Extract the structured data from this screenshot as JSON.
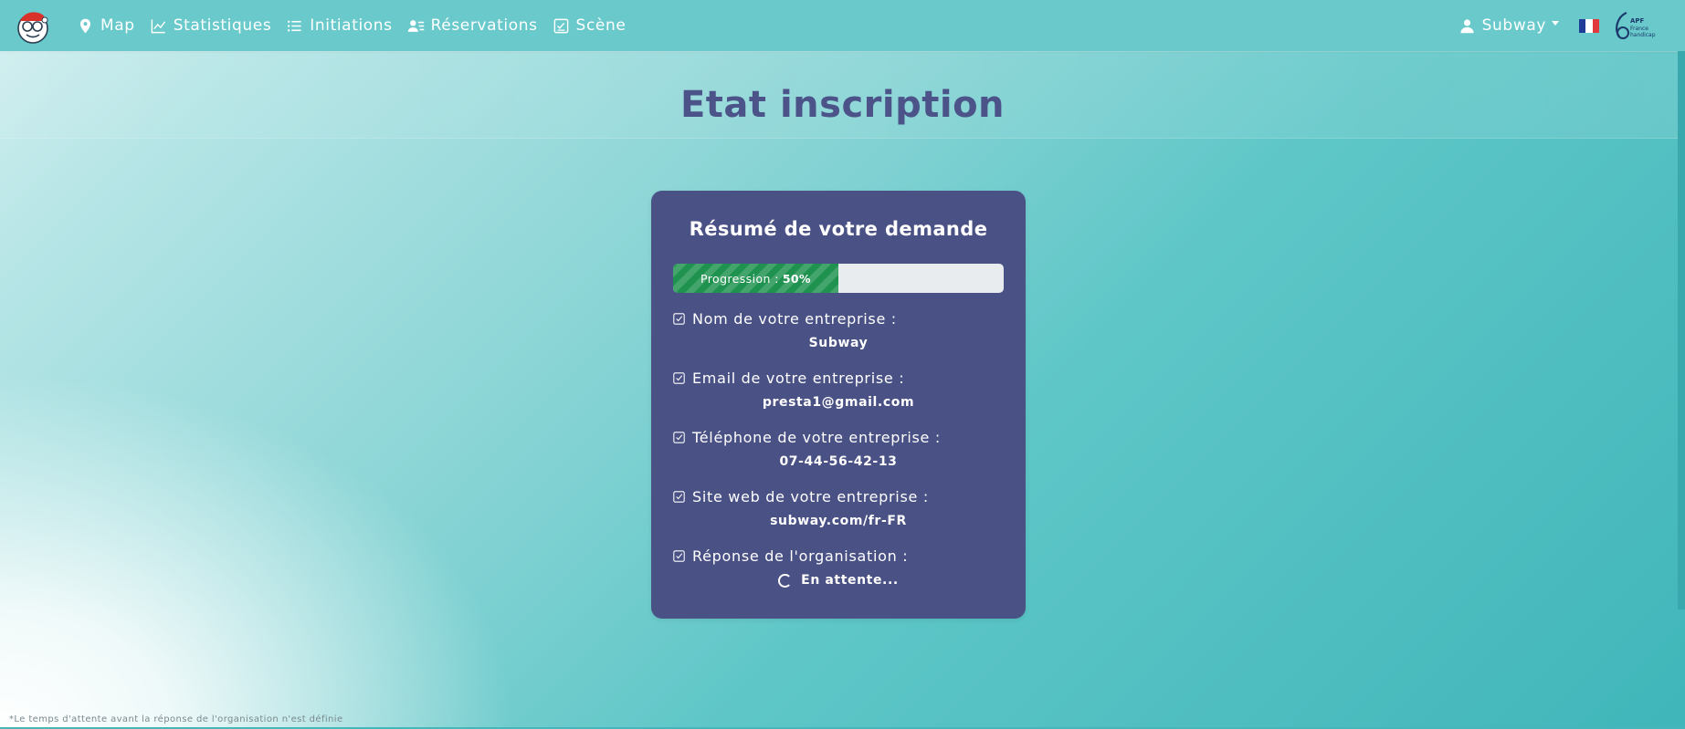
{
  "navbar": {
    "logo_alt": "logo",
    "items": [
      {
        "label": "Map",
        "icon": "map-pin-icon"
      },
      {
        "label": "Statistiques",
        "icon": "chart-line-icon"
      },
      {
        "label": "Initiations",
        "icon": "list-icon"
      },
      {
        "label": "Réservations",
        "icon": "user-list-icon"
      },
      {
        "label": "Scène",
        "icon": "checklist-icon"
      }
    ],
    "user": {
      "label": "Subway",
      "icon": "user-icon"
    },
    "language_flag": "fr-flag-icon",
    "partner_logo": "apf-france-handicap-logo"
  },
  "page": {
    "title": "Etat inscription"
  },
  "card": {
    "title": "Résumé de votre demande",
    "progress": {
      "label": "Progression :",
      "value_text": "50%",
      "value": 0.5
    },
    "fields": [
      {
        "label": "Nom de votre entreprise :",
        "value": "Subway"
      },
      {
        "label": "Email de votre entreprise :",
        "value": "presta1@gmail.com"
      },
      {
        "label": "Téléphone de votre entreprise :",
        "value": "07-44-56-42-13"
      },
      {
        "label": "Site web de votre entreprise :",
        "value": "subway.com/fr-FR"
      },
      {
        "label": "Réponse de l'organisation :",
        "value": "En attente..."
      }
    ]
  },
  "footnote": "*Le temps d'attente avant la réponse de l'organisation n'est définie",
  "colors": {
    "navbar": "#69c9cb",
    "card": "#4a5185",
    "title": "#4b5388",
    "progress_fill": "#1f9250"
  }
}
